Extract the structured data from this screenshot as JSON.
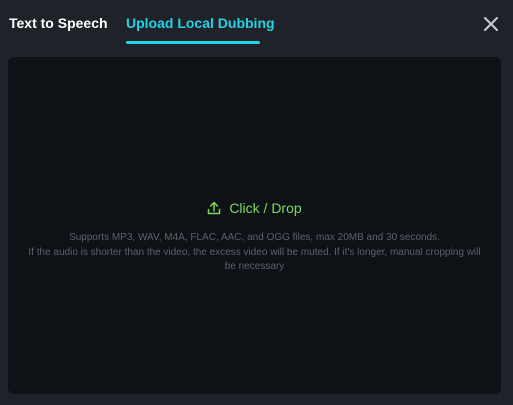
{
  "tabs": {
    "text_to_speech": "Text to Speech",
    "upload_local_dubbing": "Upload Local Dubbing",
    "active": "upload_local_dubbing"
  },
  "dropzone": {
    "cta_label": "Click / Drop",
    "cta_icon": "upload-icon",
    "hint_line1": "Supports MP3, WAV, M4A, FLAC, AAC, and OGG files, max 20MB and 30 seconds.",
    "hint_line2": "If the audio is shorter than the video, the excess video will be muted. If it's longer, manual cropping will be necessary"
  },
  "colors": {
    "accent": "#22d3e6",
    "cta": "#7ed957",
    "background": "#1f2329",
    "dropzone": "#0e1116"
  }
}
